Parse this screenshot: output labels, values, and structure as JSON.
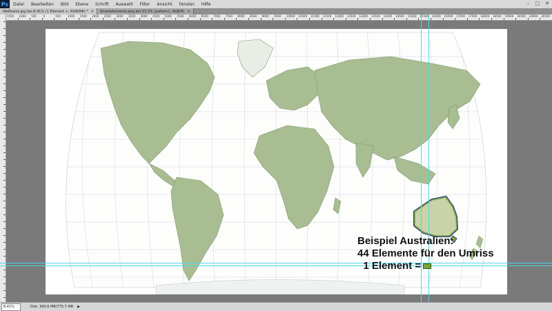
{
  "app": {
    "logo": "Ps"
  },
  "menu": [
    "Datei",
    "Bearbeiten",
    "Bild",
    "Ebene",
    "Schrift",
    "Auswahl",
    "Filter",
    "Ansicht",
    "Fenster",
    "Hilfe"
  ],
  "window_controls": [
    "–",
    "□",
    "✕"
  ],
  "tabs": [
    {
      "label": "Weltkarte.jpg bei 8,41% (1 Element +, RGB/8#) *",
      "close": "×",
      "active": true
    },
    {
      "label": "Einzelelemente.png bei 33,3% (pattern1, RGB/8)",
      "close": "×",
      "active": false
    }
  ],
  "ruler_top": [
    "1500",
    "1000",
    "500",
    "0",
    "500",
    "1000",
    "1500",
    "2000",
    "2500",
    "3000",
    "3500",
    "4000",
    "4500",
    "5000",
    "5500",
    "6000",
    "6500",
    "7000",
    "7500",
    "8000",
    "8500",
    "9000",
    "9500",
    "10000",
    "10500",
    "11000",
    "11500",
    "12000",
    "12500",
    "13000",
    "13500",
    "14000",
    "14500",
    "15000",
    "15500",
    "16000",
    "16500",
    "17000",
    "17500",
    "18000",
    "18500",
    "19000",
    "19500",
    "20000",
    "20500"
  ],
  "annotation": {
    "line1": "Beispiel Australien:",
    "line2": "44 Elemente für den Umriss",
    "line3": "1 Element ="
  },
  "status": {
    "zoom": "8,41%",
    "doc": "Dok: 390,6 MB/775,7 MB",
    "arrow": "▶"
  },
  "colors": {
    "guide": "#4fd7e8",
    "land": "#9fb88a",
    "element": "#7aa43a",
    "element_border": "#2c3f7a"
  }
}
